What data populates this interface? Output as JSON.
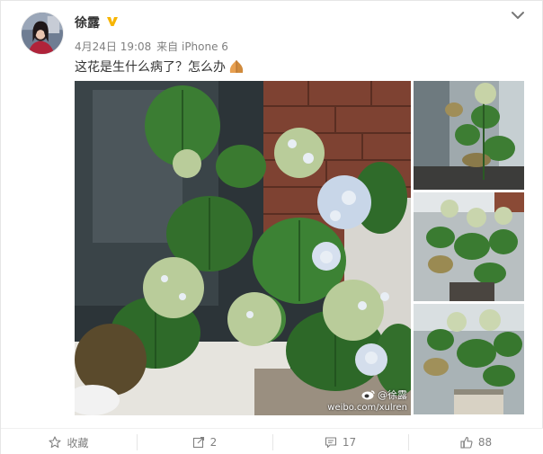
{
  "post": {
    "username": "徐露",
    "verified": true,
    "time": "4月24日 19:08",
    "from_prefix": "来自",
    "device": "iPhone 6",
    "text": "这花是生什么病了？怎么办",
    "emoji": "praying-hands-emoji"
  },
  "images": {
    "watermark_name": "@徐露",
    "watermark_url": "weibo.com/xulren"
  },
  "actions": {
    "favorite_label": "收藏",
    "repost_count": "2",
    "comment_count": "17",
    "like_count": "88"
  },
  "colors": {
    "verified_badge": "#f7b500",
    "text": "#333333",
    "meta": "#808080",
    "leaf_green": "#2e6b2a",
    "brick": "#8a4a36"
  },
  "icons": [
    "chevron-down-icon",
    "star-icon",
    "repost-icon",
    "comment-icon",
    "thumbs-up-icon",
    "verified-icon",
    "weibo-logo-icon"
  ]
}
